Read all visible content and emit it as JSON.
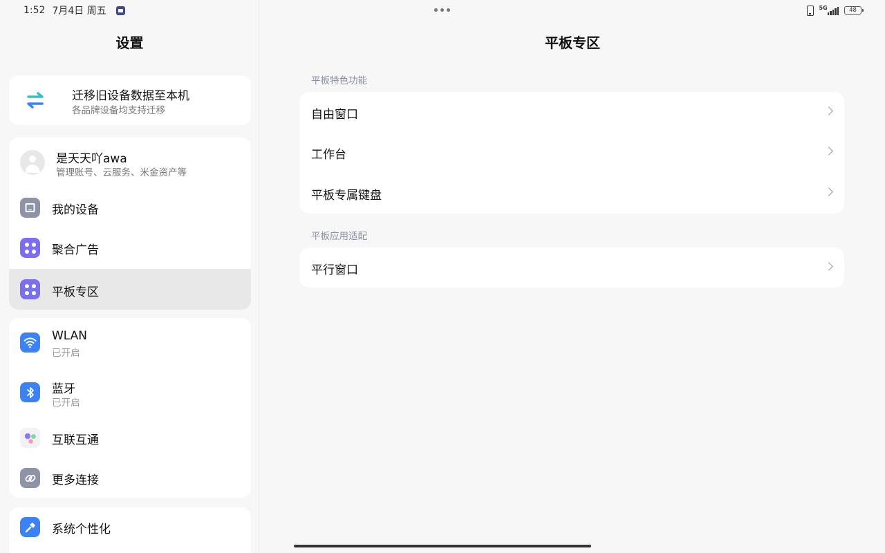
{
  "status_bar": {
    "time": "1:52",
    "date": "7月4日 周五",
    "network": "5G",
    "battery": "48"
  },
  "left": {
    "title": "设置",
    "migrate": {
      "title": "迁移旧设备数据至本机",
      "subtitle": "各品牌设备均支持迁移"
    },
    "account": {
      "name": "是天天吖awa",
      "subtitle": "管理账号、云服务、米金资产等"
    },
    "items": [
      {
        "label": "我的设备",
        "icon": "tablet-icon",
        "color": "#8e93a8"
      },
      {
        "label": "聚合广告",
        "icon": "apps-grid-icon",
        "color": "#7b6ff0"
      },
      {
        "label": "平板专区",
        "icon": "apps-grid-icon",
        "color": "#7b6ff0",
        "selected": true
      }
    ],
    "connectivity": [
      {
        "label": "WLAN",
        "sub": "已开启",
        "icon": "wifi-icon",
        "color": "#3b82f6"
      },
      {
        "label": "蓝牙",
        "sub": "已开启",
        "icon": "bluetooth-icon",
        "color": "#3b82f6"
      },
      {
        "label": "互联互通",
        "icon": "interconnect-icon"
      },
      {
        "label": "更多连接",
        "icon": "link-icon",
        "color": "#8e93a8"
      }
    ],
    "personalize": {
      "label": "系统个性化",
      "icon": "brush-icon",
      "color": "#3b82f6"
    }
  },
  "right": {
    "title": "平板专区",
    "sections": [
      {
        "header": "平板特色功能",
        "items": [
          "自由窗口",
          "工作台",
          "平板专属键盘"
        ]
      },
      {
        "header": "平板应用适配",
        "items": [
          "平行窗口"
        ]
      }
    ]
  }
}
